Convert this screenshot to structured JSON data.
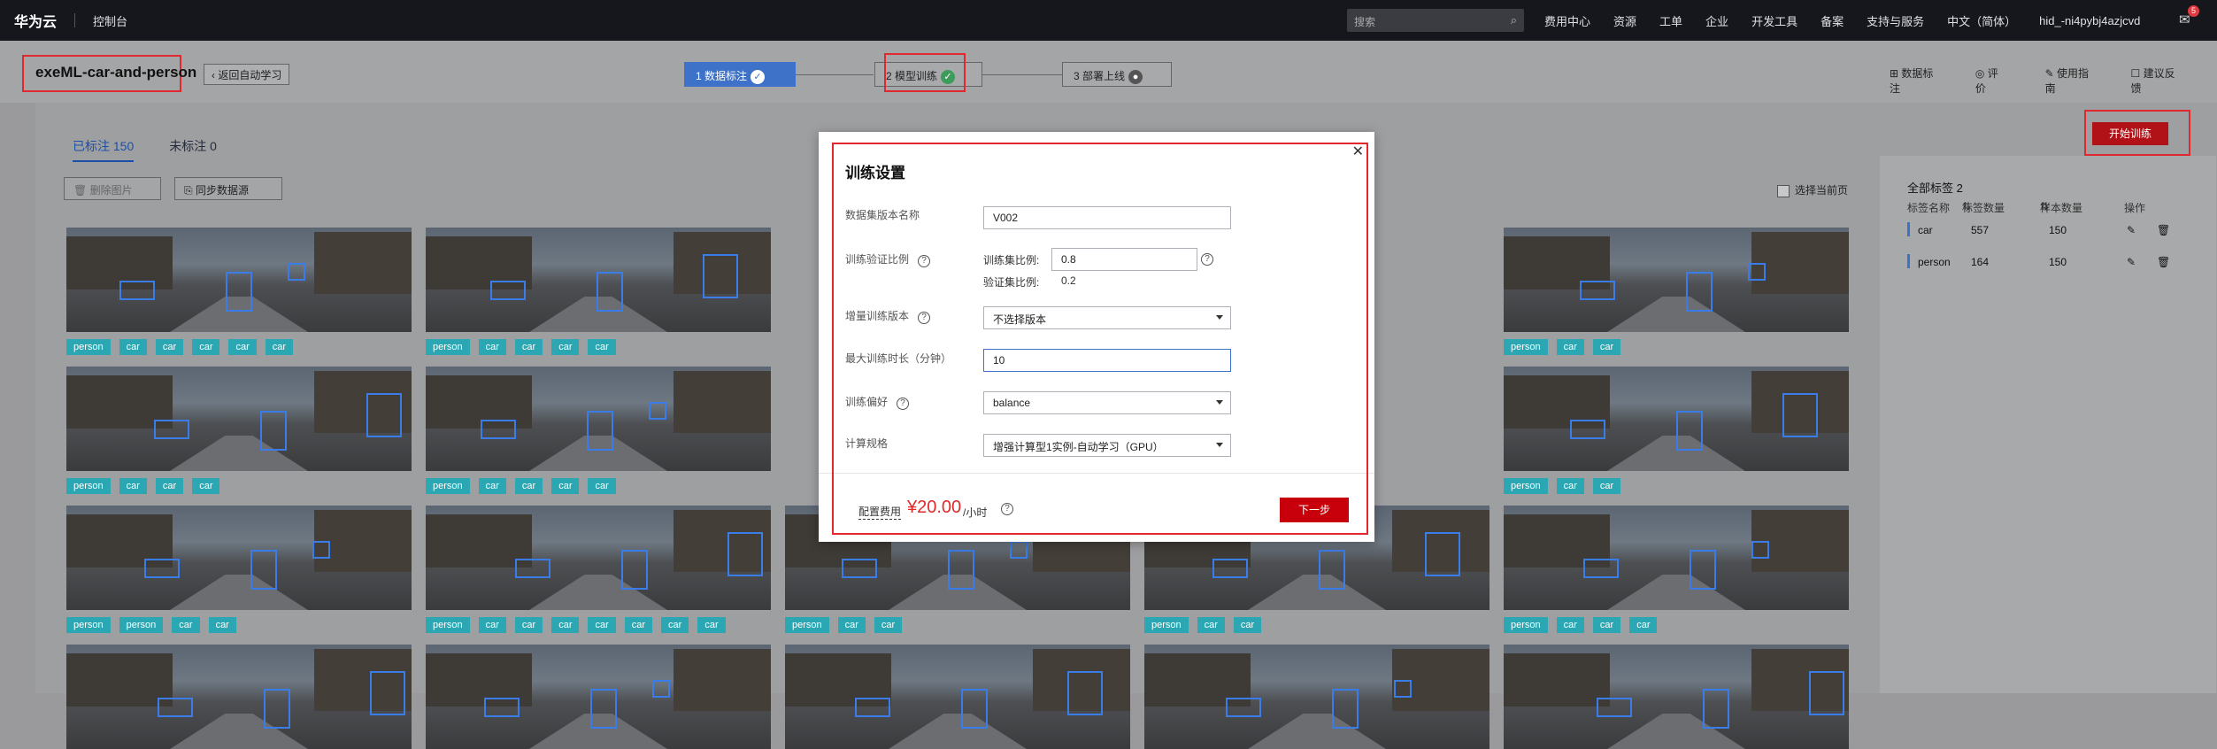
{
  "topbar": {
    "brand": "华为云",
    "console": "控制台",
    "search_placeholder": "搜索",
    "nav": [
      "费用中心",
      "资源",
      "工单",
      "企业",
      "开发工具",
      "备案",
      "支持与服务",
      "中文（简体）",
      "hid_-ni4pybj4azjcvd"
    ],
    "mail_count": "5"
  },
  "header": {
    "project_name": "exeML-car-and-person",
    "back_label": "返回自动学习",
    "steps": [
      {
        "label": "1 数据标注",
        "status": "done"
      },
      {
        "label": "2 模型训练",
        "status": "done"
      },
      {
        "label": "3 部署上线",
        "status": "pending"
      }
    ],
    "links": [
      "数据标注",
      "评价",
      "使用指南",
      "建议反馈"
    ]
  },
  "tabs": {
    "labeled": "已标注 150",
    "unlabeled": "未标注 0"
  },
  "toolbar": {
    "delete": "删除图片",
    "sync": "同步数据源",
    "select_page": "选择当前页"
  },
  "start_button": "开始训练",
  "images": [
    {
      "tags": [
        "person",
        "car",
        "car",
        "car",
        "car",
        "car"
      ]
    },
    {
      "tags": [
        "person",
        "car",
        "car",
        "car",
        "car"
      ]
    },
    {
      "tags": [
        "person",
        "car",
        "car"
      ]
    },
    {
      "tags": [
        "person",
        "car",
        "car",
        "car"
      ]
    },
    {
      "tags": [
        "person",
        "car",
        "car"
      ]
    },
    {
      "tags": [
        "person",
        "car",
        "car"
      ]
    },
    {
      "tags": [
        "person",
        "person",
        "car",
        "car"
      ]
    },
    {
      "tags": [
        "person",
        "car",
        "car",
        "car",
        "car",
        "car",
        "car",
        "car"
      ]
    },
    {
      "tags": [
        "person",
        "car",
        "car"
      ]
    },
    {
      "tags": [
        "person",
        "car",
        "car"
      ]
    },
    {
      "tags": [
        "person",
        "car",
        "car",
        "car"
      ]
    }
  ],
  "label_panel": {
    "title": "全部标签",
    "count": "2",
    "headers": [
      "标签名称",
      "标签数量",
      "样本数量",
      "操作"
    ],
    "rows": [
      {
        "name": "car",
        "label_count": "557",
        "sample_count": "150"
      },
      {
        "name": "person",
        "label_count": "164",
        "sample_count": "150"
      }
    ]
  },
  "dialog": {
    "title": "训练设置",
    "version_name_label": "数据集版本名称",
    "version_name_value": "V002",
    "split_label": "训练验证比例",
    "train_ratio_label": "训练集比例:",
    "train_ratio_value": "0.8",
    "val_ratio_label": "验证集比例:",
    "val_ratio_value": "0.2",
    "incremental_label": "增量训练版本",
    "incremental_value": "不选择版本",
    "max_time_label": "最大训练时长（分钟）",
    "max_time_value": "10",
    "preference_label": "训练偏好",
    "preference_value": "balance",
    "spec_label": "计算规格",
    "spec_value": "增强计算型1实例-自动学习（GPU）",
    "cost_label": "配置费用",
    "cost_value": "¥20.00",
    "cost_unit": "/小时",
    "next_button": "下一步"
  }
}
